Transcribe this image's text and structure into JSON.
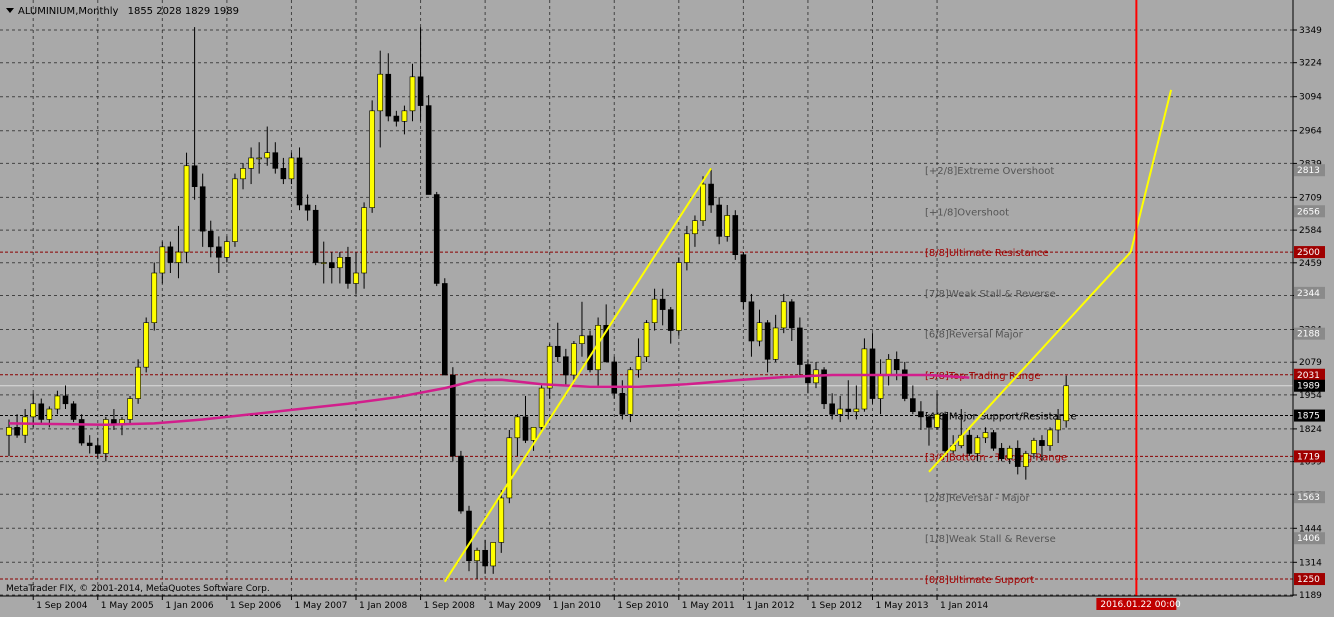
{
  "header": {
    "title": "ALUMINIUM,Monthly",
    "ohlc": "1855 2028 1829 1989"
  },
  "footer": {
    "copyright": "MetaTrader FIX, © 2001-2014, MetaQuotes Software Corp."
  },
  "colors": {
    "background": "#a9a9a9",
    "grid": "#222222",
    "bull_body": "#ffff00",
    "bear_body": "#000000",
    "moving_average": "#d21e8c",
    "trend_lines": "#ffff00",
    "vertical_marker": "#ff0000",
    "level_line": "#8b0000",
    "label_dark": "#555555",
    "label_red": "#a00000",
    "label_black": "#000000"
  },
  "chart_data": {
    "type": "candlestick",
    "symbol": "ALUMINIUM",
    "timeframe": "Monthly",
    "x": {
      "start": "2004-06",
      "end": "2014-04",
      "step": "month"
    },
    "x_ticks": [
      "1 Sep 2004",
      "1 May 2005",
      "1 Jan 2006",
      "1 Sep 2006",
      "1 May 2007",
      "1 Jan 2008",
      "1 Sep 2008",
      "1 May 2009",
      "1 Jan 2010",
      "1 Sep 2010",
      "1 May 2011",
      "1 Jan 2012",
      "1 Sep 2012",
      "1 May 2013",
      "1 Jan 2014"
    ],
    "y_ticks": [
      1189,
      1314,
      1444,
      1574,
      1699,
      1824,
      1954,
      2079,
      2204,
      2334,
      2459,
      2584,
      2709,
      2839,
      2964,
      3094,
      3224,
      3349
    ],
    "ylim": [
      1189,
      3400
    ],
    "grid": true,
    "candles": [
      [
        1800,
        1860,
        1720,
        1830
      ],
      [
        1830,
        1880,
        1790,
        1800
      ],
      [
        1800,
        1900,
        1770,
        1870
      ],
      [
        1870,
        1960,
        1830,
        1920
      ],
      [
        1920,
        1940,
        1840,
        1860
      ],
      [
        1860,
        1910,
        1830,
        1900
      ],
      [
        1900,
        1970,
        1880,
        1950
      ],
      [
        1950,
        1990,
        1900,
        1920
      ],
      [
        1920,
        1930,
        1850,
        1860
      ],
      [
        1860,
        1880,
        1760,
        1770
      ],
      [
        1770,
        1800,
        1730,
        1760
      ],
      [
        1760,
        1790,
        1710,
        1730
      ],
      [
        1730,
        1870,
        1700,
        1860
      ],
      [
        1860,
        1900,
        1820,
        1840
      ],
      [
        1840,
        1870,
        1800,
        1860
      ],
      [
        1860,
        1950,
        1840,
        1940
      ],
      [
        1940,
        2090,
        1920,
        2060
      ],
      [
        2060,
        2250,
        2040,
        2230
      ],
      [
        2230,
        2460,
        2200,
        2420
      ],
      [
        2420,
        2540,
        2380,
        2520
      ],
      [
        2520,
        2540,
        2420,
        2460
      ],
      [
        2460,
        2600,
        2400,
        2500
      ],
      [
        2500,
        2880,
        2460,
        2830
      ],
      [
        2830,
        3360,
        2700,
        2750
      ],
      [
        2750,
        2800,
        2520,
        2580
      ],
      [
        2580,
        2620,
        2480,
        2520
      ],
      [
        2520,
        2560,
        2420,
        2480
      ],
      [
        2480,
        2560,
        2460,
        2540
      ],
      [
        2540,
        2800,
        2520,
        2780
      ],
      [
        2780,
        2840,
        2740,
        2820
      ],
      [
        2820,
        2900,
        2760,
        2860
      ],
      [
        2860,
        2920,
        2800,
        2860
      ],
      [
        2860,
        2980,
        2830,
        2880
      ],
      [
        2880,
        2920,
        2800,
        2820
      ],
      [
        2820,
        2860,
        2760,
        2780
      ],
      [
        2780,
        2880,
        2760,
        2860
      ],
      [
        2860,
        2900,
        2660,
        2680
      ],
      [
        2680,
        2720,
        2620,
        2660
      ],
      [
        2660,
        2680,
        2450,
        2460
      ],
      [
        2460,
        2540,
        2380,
        2460
      ],
      [
        2460,
        2500,
        2380,
        2440
      ],
      [
        2440,
        2500,
        2380,
        2480
      ],
      [
        2480,
        2520,
        2360,
        2380
      ],
      [
        2380,
        2500,
        2340,
        2420
      ],
      [
        2420,
        2690,
        2360,
        2670
      ],
      [
        2670,
        3080,
        2650,
        3040
      ],
      [
        3040,
        3270,
        2900,
        3180
      ],
      [
        3180,
        3260,
        3000,
        3020
      ],
      [
        3020,
        3040,
        2980,
        3000
      ],
      [
        3000,
        3060,
        2950,
        3040
      ],
      [
        3040,
        3220,
        3000,
        3170
      ],
      [
        3170,
        3360,
        3000,
        3060
      ],
      [
        3060,
        3100,
        2720,
        2720
      ],
      [
        2720,
        2730,
        2370,
        2380
      ],
      [
        2380,
        2400,
        2030,
        2030
      ],
      [
        2030,
        2060,
        1700,
        1720
      ],
      [
        1720,
        1740,
        1500,
        1510
      ],
      [
        1510,
        1530,
        1280,
        1320
      ],
      [
        1320,
        1370,
        1250,
        1360
      ],
      [
        1360,
        1400,
        1270,
        1300
      ],
      [
        1300,
        1390,
        1270,
        1390
      ],
      [
        1390,
        1590,
        1350,
        1560
      ],
      [
        1560,
        1820,
        1540,
        1790
      ],
      [
        1790,
        1880,
        1720,
        1870
      ],
      [
        1870,
        1950,
        1770,
        1780
      ],
      [
        1780,
        1830,
        1740,
        1830
      ],
      [
        1830,
        1990,
        1820,
        1980
      ],
      [
        1980,
        2150,
        1940,
        2140
      ],
      [
        2140,
        2230,
        2080,
        2100
      ],
      [
        2100,
        2130,
        1990,
        2030
      ],
      [
        2030,
        2160,
        2000,
        2150
      ],
      [
        2150,
        2310,
        2100,
        2180
      ],
      [
        2180,
        2200,
        2040,
        2050
      ],
      [
        2050,
        2250,
        1990,
        2220
      ],
      [
        2220,
        2300,
        2080,
        2080
      ],
      [
        2080,
        2100,
        1940,
        1960
      ],
      [
        1960,
        2010,
        1860,
        1880
      ],
      [
        1880,
        2060,
        1850,
        2050
      ],
      [
        2050,
        2170,
        2020,
        2100
      ],
      [
        2100,
        2240,
        2080,
        2230
      ],
      [
        2230,
        2360,
        2200,
        2320
      ],
      [
        2320,
        2360,
        2220,
        2280
      ],
      [
        2280,
        2290,
        2150,
        2200
      ],
      [
        2200,
        2480,
        2180,
        2460
      ],
      [
        2460,
        2600,
        2430,
        2570
      ],
      [
        2570,
        2640,
        2520,
        2620
      ],
      [
        2620,
        2790,
        2600,
        2760
      ],
      [
        2760,
        2820,
        2650,
        2680
      ],
      [
        2680,
        2710,
        2530,
        2560
      ],
      [
        2560,
        2680,
        2540,
        2640
      ],
      [
        2640,
        2660,
        2470,
        2490
      ],
      [
        2490,
        2500,
        2280,
        2310
      ],
      [
        2310,
        2340,
        2100,
        2160
      ],
      [
        2160,
        2280,
        2140,
        2230
      ],
      [
        2230,
        2240,
        2040,
        2090
      ],
      [
        2090,
        2260,
        2080,
        2210
      ],
      [
        2210,
        2340,
        2190,
        2310
      ],
      [
        2310,
        2320,
        2160,
        2210
      ],
      [
        2210,
        2250,
        2030,
        2070
      ],
      [
        2070,
        2090,
        1960,
        2000
      ],
      [
        2000,
        2080,
        1980,
        2050
      ],
      [
        2050,
        2060,
        1900,
        1920
      ],
      [
        1920,
        1960,
        1860,
        1880
      ],
      [
        1880,
        1950,
        1850,
        1900
      ],
      [
        1900,
        2010,
        1860,
        1890
      ],
      [
        1890,
        1990,
        1860,
        1900
      ],
      [
        1900,
        2170,
        1890,
        2130
      ],
      [
        2130,
        2190,
        1920,
        1940
      ],
      [
        1940,
        2090,
        1880,
        2030
      ],
      [
        2030,
        2110,
        1990,
        2090
      ],
      [
        2090,
        2120,
        2010,
        2050
      ],
      [
        2050,
        2080,
        1930,
        1940
      ],
      [
        1940,
        1990,
        1880,
        1890
      ],
      [
        1890,
        1930,
        1820,
        1870
      ],
      [
        1870,
        1880,
        1760,
        1830
      ],
      [
        1830,
        1960,
        1820,
        1880
      ],
      [
        1880,
        1890,
        1730,
        1740
      ],
      [
        1740,
        1800,
        1730,
        1760
      ],
      [
        1760,
        1900,
        1750,
        1800
      ],
      [
        1800,
        1820,
        1720,
        1730
      ],
      [
        1730,
        1800,
        1700,
        1790
      ],
      [
        1790,
        1830,
        1770,
        1810
      ],
      [
        1810,
        1820,
        1740,
        1750
      ],
      [
        1750,
        1770,
        1700,
        1710
      ],
      [
        1710,
        1760,
        1690,
        1750
      ],
      [
        1750,
        1780,
        1650,
        1680
      ],
      [
        1680,
        1740,
        1630,
        1730
      ],
      [
        1730,
        1790,
        1710,
        1780
      ],
      [
        1780,
        1800,
        1700,
        1760
      ],
      [
        1760,
        1830,
        1740,
        1820
      ],
      [
        1820,
        1900,
        1770,
        1860
      ],
      [
        1855,
        2028,
        1829,
        1989
      ]
    ],
    "moving_average": {
      "name": "",
      "values": [
        [
          0,
          1845
        ],
        [
          12,
          1840
        ],
        [
          18,
          1845
        ],
        [
          24,
          1860
        ],
        [
          30,
          1880
        ],
        [
          36,
          1900
        ],
        [
          42,
          1920
        ],
        [
          48,
          1945
        ],
        [
          54,
          1980
        ],
        [
          58,
          2010
        ],
        [
          61,
          2012
        ],
        [
          66,
          1995
        ],
        [
          72,
          1985
        ],
        [
          78,
          1985
        ],
        [
          84,
          1995
        ],
        [
          90,
          2010
        ],
        [
          96,
          2022
        ],
        [
          102,
          2030
        ],
        [
          108,
          2030
        ],
        [
          114,
          2030
        ],
        [
          119,
          2020
        ]
      ]
    },
    "trend_lines": [
      {
        "from": [
          "2008-12",
          1240
        ],
        "to": [
          "2011-09",
          2820
        ]
      },
      {
        "from": [
          "2013-12",
          1660
        ],
        "to": [
          "2016-01",
          2500
        ]
      },
      {
        "from": [
          "2016-01",
          2500
        ],
        "to": [
          "2016-06",
          3120
        ]
      }
    ],
    "vertical_line": {
      "date": "2016-01-22",
      "label": "2016.01.22 00:00"
    },
    "murrey_levels": [
      {
        "label": "[+2/8]Extreme Overshoot",
        "value": 2813,
        "price_tag": "2813",
        "line": false,
        "style": "dark"
      },
      {
        "label": "[+1/8]Overshoot",
        "value": 2656,
        "price_tag": "2656",
        "line": false,
        "style": "dark"
      },
      {
        "label": "[8/8]Ultimate Resistance",
        "value": 2500,
        "price_tag": "2500",
        "line": true,
        "style": "red"
      },
      {
        "label": "[7/8]Weak Stall & Reverse",
        "value": 2344,
        "price_tag": "2344",
        "line": false,
        "style": "dark"
      },
      {
        "label": "[6/8]Reversal Major",
        "value": 2188,
        "price_tag": "2188",
        "line": false,
        "style": "dark"
      },
      {
        "label": "[5/8]Top Trading Range",
        "value": 2031,
        "price_tag": "2031",
        "line": true,
        "style": "red"
      },
      {
        "label": "[4/8]Major Support/Resistance",
        "value": 1875,
        "price_tag": "1875",
        "line": true,
        "style": "black"
      },
      {
        "label": "[3/8]Bottom - Trading Range",
        "value": 1719,
        "price_tag": "1719",
        "line": true,
        "style": "red"
      },
      {
        "label": "[2/8]Reversal - Major",
        "value": 1563,
        "price_tag": "1563",
        "line": false,
        "style": "dark"
      },
      {
        "label": "[1/8]Weak Stall & Reverse",
        "value": 1406,
        "price_tag": "1406",
        "line": false,
        "style": "dark"
      },
      {
        "label": "[0/8]Ultimate Support",
        "value": 1250,
        "price_tag": "1250",
        "line": true,
        "style": "red"
      }
    ],
    "current_price": {
      "value": 1989,
      "label": "1989"
    }
  }
}
